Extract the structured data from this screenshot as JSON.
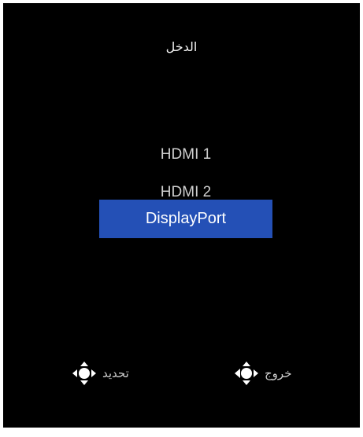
{
  "osd": {
    "title": "الدخل",
    "inputs": [
      {
        "label": "HDMI 1",
        "selected": false
      },
      {
        "label": "HDMI 2",
        "selected": false
      },
      {
        "label": "DisplayPort",
        "selected": true
      }
    ],
    "footer": {
      "select_label": "تحديد",
      "exit_label": "خروج"
    },
    "colors": {
      "background": "#000000",
      "highlight": "#2450b6",
      "text": "#cfcfcf"
    },
    "icons": [
      "joystick-select-icon",
      "joystick-back-icon"
    ]
  }
}
